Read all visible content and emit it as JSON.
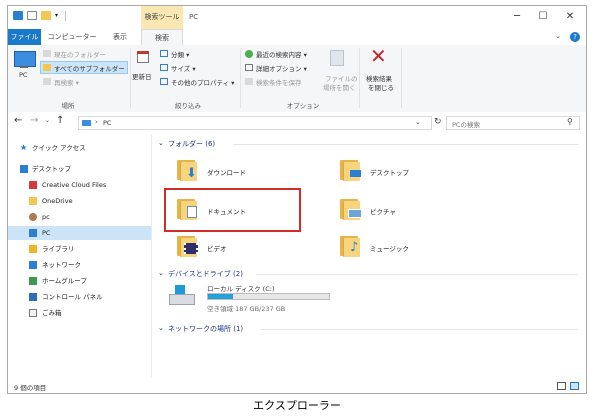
{
  "titlebar": {
    "tool_tab": "検索ツール",
    "title": "PC",
    "minimize": "─",
    "maximize": "☐",
    "close": "✕"
  },
  "tabs": {
    "file": "ファイル",
    "computer": "コンピューター",
    "view": "表示",
    "search": "検索"
  },
  "ribbon": {
    "pc_label": "PC",
    "current_folder": "現在のフォルダー",
    "all_subfolders": "すべてのサブフォルダー",
    "search_again": "再検索 ▾",
    "group_location": "場所",
    "date_modified": "更新日",
    "kind": "分類 ▾",
    "size": "サイズ ▾",
    "other_props": "その他のプロパティ ▾",
    "group_refine": "絞り込み",
    "recent_searches": "最近の検索内容 ▾",
    "advanced_options": "詳細オプション ▾",
    "save_search": "検索条件を保存",
    "open_file_location_1": "ファイルの",
    "open_file_location_2": "場所を開く",
    "group_options": "オプション",
    "close_search_1": "検索結果",
    "close_search_2": "を閉じる"
  },
  "address": {
    "path": "PC",
    "search_placeholder": "PCの検索"
  },
  "nav": {
    "quick_access": "クイック アクセス",
    "desktop": "デスクトップ",
    "creative_cloud": "Creative Cloud Files",
    "onedrive": "OneDrive",
    "user": "pc",
    "pc": "PC",
    "library": "ライブラリ",
    "network": "ネットワーク",
    "homegroup": "ホームグループ",
    "control_panel": "コントロール パネル",
    "recycle_bin": "ごみ箱"
  },
  "main": {
    "folders_header": "フォルダー (6)",
    "folders": {
      "downloads": "ダウンロード",
      "desktop": "デスクトップ",
      "documents": "ドキュメント",
      "pictures": "ピクチャ",
      "videos": "ビデオ",
      "music": "ミュージック"
    },
    "devices_header": "デバイスとドライブ (2)",
    "drive": {
      "name": "ローカル ディスク (C:)",
      "free_text": "空き領域 187 GB/237 GB",
      "used_fraction": 0.21
    },
    "network_header": "ネットワークの場所 (1)"
  },
  "status": {
    "count": "9 個の項目"
  },
  "caption": "エクスプローラー",
  "colors": {
    "accent": "#1979ca",
    "tool_tab": "#fbe7b2",
    "highlight_box": "#d12d26",
    "selected_nav": "#cce4f7",
    "group_header": "#1e3287"
  }
}
